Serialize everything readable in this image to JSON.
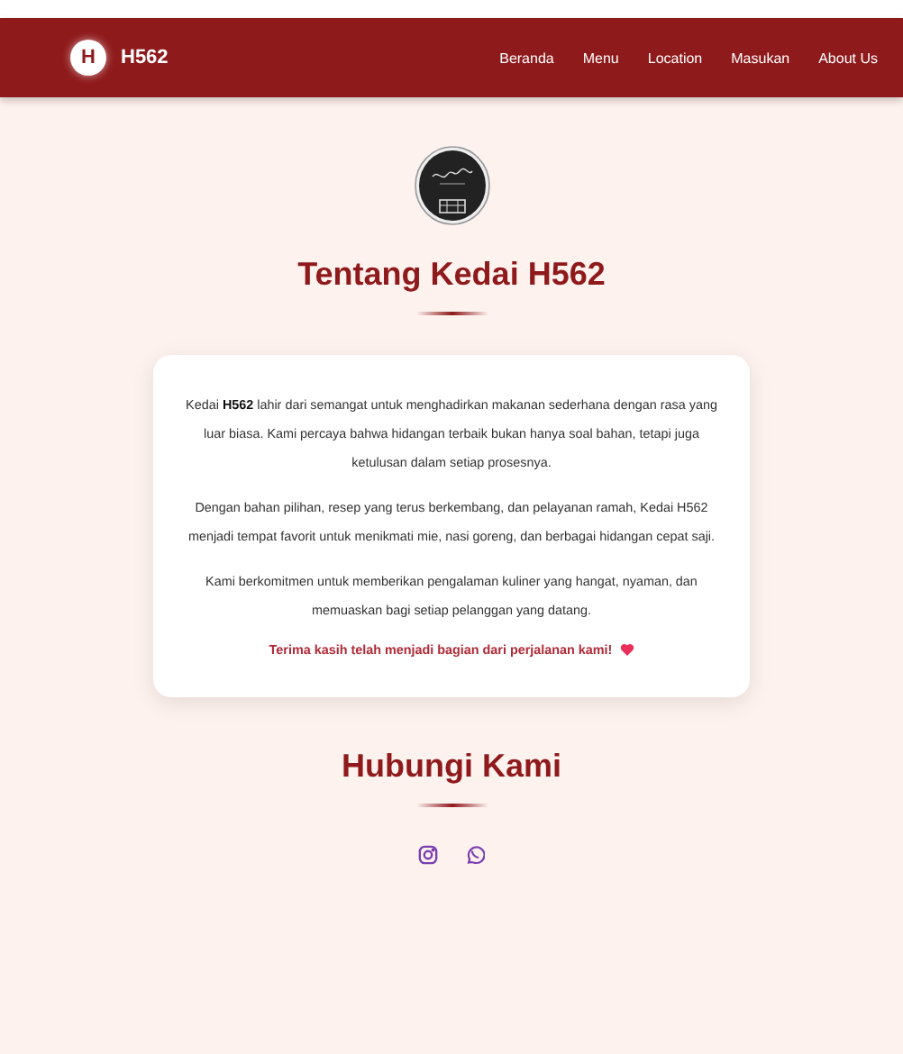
{
  "navbar": {
    "brand_mark": "H",
    "brand": "H562",
    "links": [
      {
        "label": "Beranda"
      },
      {
        "label": "Menu"
      },
      {
        "label": "Location"
      },
      {
        "label": "Masukan"
      },
      {
        "label": "About Us"
      }
    ]
  },
  "about": {
    "title": "Tentang Kedai H562",
    "paragraphs": [
      "Kedai **H562** lahir dari semangat untuk menghadirkan makanan sederhana dengan rasa yang luar biasa. Kami percaya bahwa hidangan terbaik bukan hanya soal bahan, tetapi juga ketulusan dalam setiap prosesnya.",
      "Dengan bahan pilihan, resep yang terus berkembang, dan pelayanan ramah, Kedai H562 menjadi tempat favorit untuk menikmati mie, nasi goreng, dan berbagai hidangan cepat saji.",
      "Kami berkomitmen untuk memberikan pengalaman kuliner yang hangat, nyaman, dan memuaskan bagi setiap pelanggan yang datang."
    ],
    "thanks": "Terima kasih telah menjadi bagian dari perjalanan kami!"
  },
  "contact": {
    "title": "Hubungi Kami",
    "links": [
      {
        "kind": "instagram"
      },
      {
        "kind": "whatsapp"
      }
    ]
  }
}
